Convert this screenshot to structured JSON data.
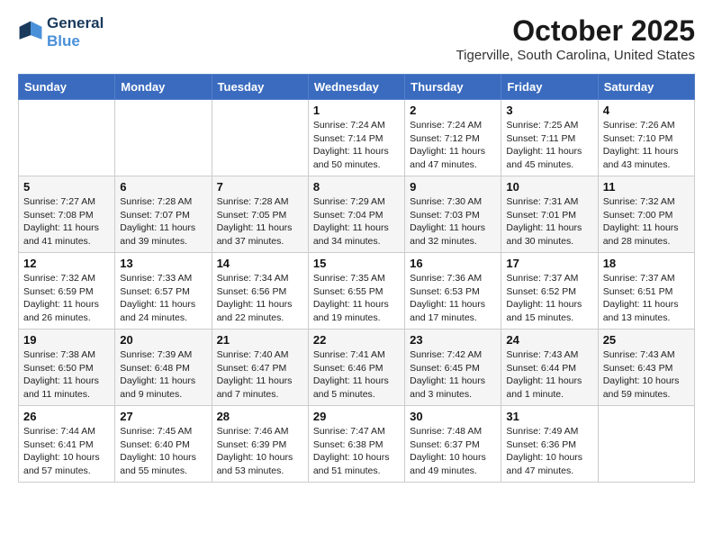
{
  "header": {
    "logo_line1": "General",
    "logo_line2": "Blue",
    "month": "October 2025",
    "location": "Tigerville, South Carolina, United States"
  },
  "weekdays": [
    "Sunday",
    "Monday",
    "Tuesday",
    "Wednesday",
    "Thursday",
    "Friday",
    "Saturday"
  ],
  "weeks": [
    [
      {
        "day": "",
        "info": ""
      },
      {
        "day": "",
        "info": ""
      },
      {
        "day": "",
        "info": ""
      },
      {
        "day": "1",
        "info": "Sunrise: 7:24 AM\nSunset: 7:14 PM\nDaylight: 11 hours\nand 50 minutes."
      },
      {
        "day": "2",
        "info": "Sunrise: 7:24 AM\nSunset: 7:12 PM\nDaylight: 11 hours\nand 47 minutes."
      },
      {
        "day": "3",
        "info": "Sunrise: 7:25 AM\nSunset: 7:11 PM\nDaylight: 11 hours\nand 45 minutes."
      },
      {
        "day": "4",
        "info": "Sunrise: 7:26 AM\nSunset: 7:10 PM\nDaylight: 11 hours\nand 43 minutes."
      }
    ],
    [
      {
        "day": "5",
        "info": "Sunrise: 7:27 AM\nSunset: 7:08 PM\nDaylight: 11 hours\nand 41 minutes."
      },
      {
        "day": "6",
        "info": "Sunrise: 7:28 AM\nSunset: 7:07 PM\nDaylight: 11 hours\nand 39 minutes."
      },
      {
        "day": "7",
        "info": "Sunrise: 7:28 AM\nSunset: 7:05 PM\nDaylight: 11 hours\nand 37 minutes."
      },
      {
        "day": "8",
        "info": "Sunrise: 7:29 AM\nSunset: 7:04 PM\nDaylight: 11 hours\nand 34 minutes."
      },
      {
        "day": "9",
        "info": "Sunrise: 7:30 AM\nSunset: 7:03 PM\nDaylight: 11 hours\nand 32 minutes."
      },
      {
        "day": "10",
        "info": "Sunrise: 7:31 AM\nSunset: 7:01 PM\nDaylight: 11 hours\nand 30 minutes."
      },
      {
        "day": "11",
        "info": "Sunrise: 7:32 AM\nSunset: 7:00 PM\nDaylight: 11 hours\nand 28 minutes."
      }
    ],
    [
      {
        "day": "12",
        "info": "Sunrise: 7:32 AM\nSunset: 6:59 PM\nDaylight: 11 hours\nand 26 minutes."
      },
      {
        "day": "13",
        "info": "Sunrise: 7:33 AM\nSunset: 6:57 PM\nDaylight: 11 hours\nand 24 minutes."
      },
      {
        "day": "14",
        "info": "Sunrise: 7:34 AM\nSunset: 6:56 PM\nDaylight: 11 hours\nand 22 minutes."
      },
      {
        "day": "15",
        "info": "Sunrise: 7:35 AM\nSunset: 6:55 PM\nDaylight: 11 hours\nand 19 minutes."
      },
      {
        "day": "16",
        "info": "Sunrise: 7:36 AM\nSunset: 6:53 PM\nDaylight: 11 hours\nand 17 minutes."
      },
      {
        "day": "17",
        "info": "Sunrise: 7:37 AM\nSunset: 6:52 PM\nDaylight: 11 hours\nand 15 minutes."
      },
      {
        "day": "18",
        "info": "Sunrise: 7:37 AM\nSunset: 6:51 PM\nDaylight: 11 hours\nand 13 minutes."
      }
    ],
    [
      {
        "day": "19",
        "info": "Sunrise: 7:38 AM\nSunset: 6:50 PM\nDaylight: 11 hours\nand 11 minutes."
      },
      {
        "day": "20",
        "info": "Sunrise: 7:39 AM\nSunset: 6:48 PM\nDaylight: 11 hours\nand 9 minutes."
      },
      {
        "day": "21",
        "info": "Sunrise: 7:40 AM\nSunset: 6:47 PM\nDaylight: 11 hours\nand 7 minutes."
      },
      {
        "day": "22",
        "info": "Sunrise: 7:41 AM\nSunset: 6:46 PM\nDaylight: 11 hours\nand 5 minutes."
      },
      {
        "day": "23",
        "info": "Sunrise: 7:42 AM\nSunset: 6:45 PM\nDaylight: 11 hours\nand 3 minutes."
      },
      {
        "day": "24",
        "info": "Sunrise: 7:43 AM\nSunset: 6:44 PM\nDaylight: 11 hours\nand 1 minute."
      },
      {
        "day": "25",
        "info": "Sunrise: 7:43 AM\nSunset: 6:43 PM\nDaylight: 10 hours\nand 59 minutes."
      }
    ],
    [
      {
        "day": "26",
        "info": "Sunrise: 7:44 AM\nSunset: 6:41 PM\nDaylight: 10 hours\nand 57 minutes."
      },
      {
        "day": "27",
        "info": "Sunrise: 7:45 AM\nSunset: 6:40 PM\nDaylight: 10 hours\nand 55 minutes."
      },
      {
        "day": "28",
        "info": "Sunrise: 7:46 AM\nSunset: 6:39 PM\nDaylight: 10 hours\nand 53 minutes."
      },
      {
        "day": "29",
        "info": "Sunrise: 7:47 AM\nSunset: 6:38 PM\nDaylight: 10 hours\nand 51 minutes."
      },
      {
        "day": "30",
        "info": "Sunrise: 7:48 AM\nSunset: 6:37 PM\nDaylight: 10 hours\nand 49 minutes."
      },
      {
        "day": "31",
        "info": "Sunrise: 7:49 AM\nSunset: 6:36 PM\nDaylight: 10 hours\nand 47 minutes."
      },
      {
        "day": "",
        "info": ""
      }
    ]
  ]
}
